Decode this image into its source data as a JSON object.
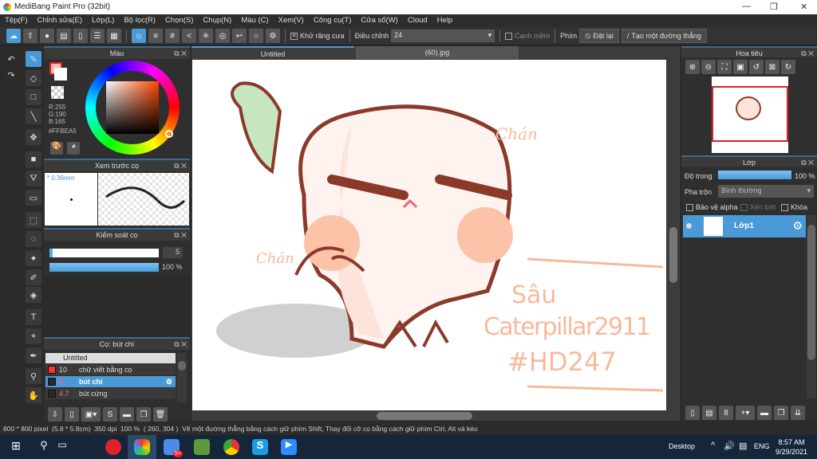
{
  "window": {
    "title": "MediBang Paint Pro (32bit)"
  },
  "menu": [
    "Tệp(F)",
    "Chỉnh sửa(E)",
    "Lớp(L)",
    "Bộ lọc(R)",
    "Chọn(S)",
    "Chụp(N)",
    "Màu (C)",
    "Xem(V)",
    "Công cụ(T)",
    "Cửa sổ(W)",
    "Cloud",
    "Help"
  ],
  "toolbar": {
    "antialias_label": "Khử răng cưa",
    "adjust_label": "Điều chỉnh",
    "adjust_value": "24",
    "smooth_label": "Cạnh mềm",
    "key_label": "Phím",
    "reset_label": "Đặt lại",
    "line_label": "Tạo một đường thẳng"
  },
  "color_panel": {
    "title": "Màu",
    "r": "R:255",
    "g": "G:190",
    "b": "B:165",
    "hex": "#FFBEA5",
    "fg": "#ffbea5"
  },
  "brush_preview": {
    "title": "Xem trước cọ",
    "size": "* 0.36mm"
  },
  "brush_control": {
    "title": "Kiểm soát cọ",
    "size_value": "5",
    "opacity": "100 %",
    "size_fraction": 0.03,
    "opacity_fraction": 1.0
  },
  "brush_panel": {
    "title": "Cọ: bút chì",
    "group": "Untitled",
    "items": [
      {
        "size": "10",
        "name": "chữ viết bằng cọ",
        "color": "#ff3030"
      },
      {
        "size": "5",
        "name": "bút chì",
        "color": "#1e2a3a"
      },
      {
        "size": "4.7",
        "name": "bút cứng",
        "color": "#2a2a2a"
      }
    ]
  },
  "tabs": [
    "Untitled",
    "(60).jpg"
  ],
  "artwork": {
    "text1": "Chán",
    "text2": "Chán",
    "line1": "Sâu",
    "line2": "Caterpillar2911",
    "line3": "#HD247"
  },
  "navigator": {
    "title": "Hoa tiêu"
  },
  "layer_panel": {
    "title": "Lớp",
    "opacity_label": "Độ trong",
    "opacity_value": "100 %",
    "blend_label": "Pha trộn",
    "blend_value": "Bình thường",
    "protect_alpha": "Bảo vệ alpha",
    "clip": "Xén bớt",
    "lock": "Khóa",
    "layers": [
      {
        "name": "Lớp1"
      }
    ]
  },
  "status": {
    "size": "800 * 800 pixel",
    "cm": "(5.8 * 5.8cm)",
    "dpi": "350 dpi",
    "zoom": "100 %",
    "coords": "( 260, 304 )",
    "hint": "Vẽ một đường thẳng bằng cách giữ phím Shift, Thay đổi cỡ cọ bằng cách giữ phím Ctrl, Alt và kéo"
  },
  "taskbar": {
    "desktop": "Desktop",
    "lang": "ENG",
    "time": "8:57 AM",
    "date": "9/29/2021",
    "badge": "5+"
  }
}
